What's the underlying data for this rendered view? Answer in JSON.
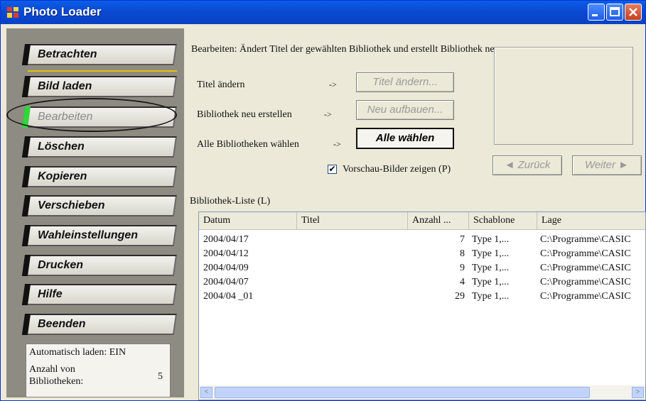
{
  "window": {
    "title": "Photo Loader",
    "icon": "photo-loader-app-icon"
  },
  "sidebar": {
    "items": [
      {
        "label": "Betrachten",
        "active": false
      },
      {
        "label": "Bild laden",
        "active": false
      },
      {
        "label": "Bearbeiten",
        "active": true
      },
      {
        "label": "Löschen",
        "active": false
      },
      {
        "label": "Kopieren",
        "active": false
      },
      {
        "label": "Verschieben",
        "active": false
      },
      {
        "label": "Wahleinstellungen",
        "active": false
      },
      {
        "label": "Drucken",
        "active": false
      },
      {
        "label": "Hilfe",
        "active": false
      },
      {
        "label": "Beenden",
        "active": false
      }
    ],
    "info": {
      "auto_load": "Automatisch laden: EIN",
      "lib_count_label": "Anzahl von Bibliotheken:",
      "lib_count_value": "5"
    }
  },
  "main": {
    "description": "Bearbeiten: Ändert Titel der gewählten Bibliothek und erstellt Bibliothek neu",
    "actions": [
      {
        "label": "Titel ändern",
        "arrow": "->",
        "button": "Titel ändern...",
        "enabled": false
      },
      {
        "label": "Bibliothek neu erstellen",
        "arrow": "->",
        "button": "Neu aufbauen...",
        "enabled": false
      },
      {
        "label": "Alle Bibliotheken wählen",
        "arrow": "->",
        "button": "Alle wählen",
        "enabled": true
      }
    ],
    "preview_checkbox": {
      "label": "Vorschau-Bilder zeigen (P)",
      "checked": true
    },
    "nav": {
      "back": "◄ Zurück",
      "next": "Weiter ►"
    },
    "list_label": "Bibliothek-Liste (L)",
    "columns": [
      "Datum",
      "Titel",
      "Anzahl ...",
      "Schablone",
      "Lage"
    ],
    "rows": [
      {
        "datum": "2004/04/17",
        "titel": "",
        "anzahl": "7",
        "schablone": "Type 1,...",
        "lage": "C:\\Programme\\CASIC"
      },
      {
        "datum": "2004/04/12",
        "titel": "",
        "anzahl": "8",
        "schablone": "Type 1,...",
        "lage": "C:\\Programme\\CASIC"
      },
      {
        "datum": "2004/04/09",
        "titel": "",
        "anzahl": "9",
        "schablone": "Type 1,...",
        "lage": "C:\\Programme\\CASIC"
      },
      {
        "datum": "2004/04/07",
        "titel": "",
        "anzahl": "4",
        "schablone": "Type 1,...",
        "lage": "C:\\Programme\\CASIC"
      },
      {
        "datum": "2004/04 _01",
        "titel": "",
        "anzahl": "29",
        "schablone": "Type 1,...",
        "lage": "C:\\Programme\\CASIC"
      }
    ],
    "scrollbar": {
      "left_arrow": "<",
      "right_arrow": ">"
    }
  },
  "colors": {
    "titlebar": "#0b49d3",
    "active_indicator": "#2fd73a",
    "separator": "#e6c300"
  }
}
